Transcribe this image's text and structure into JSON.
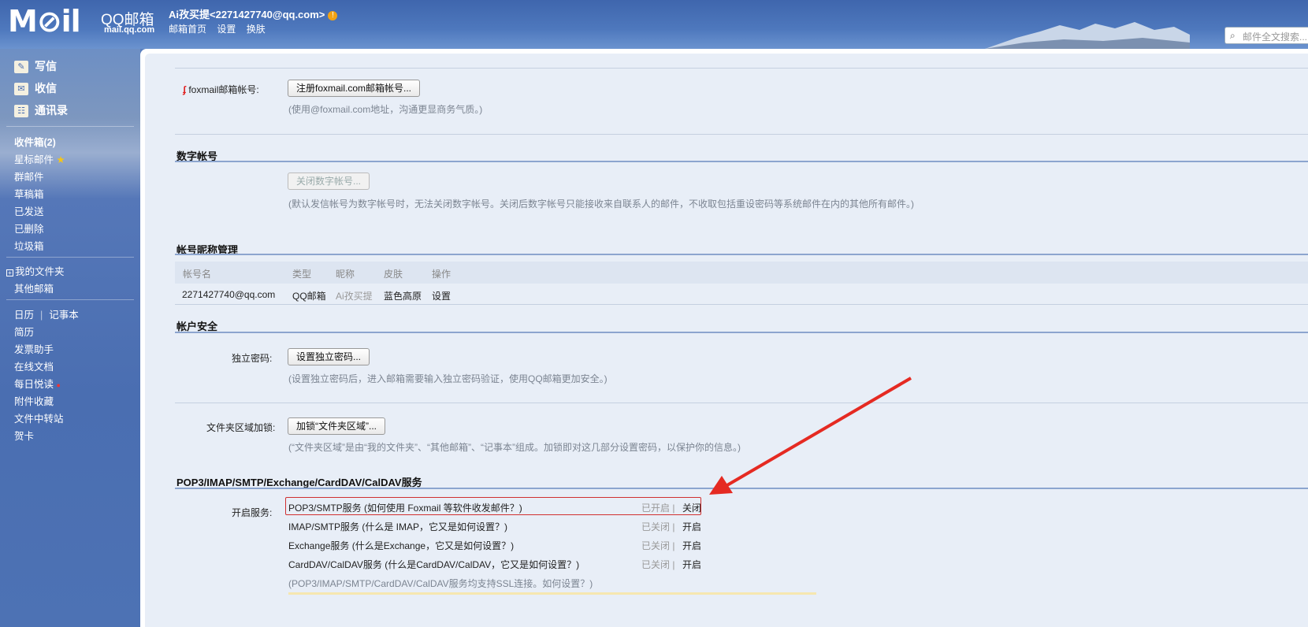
{
  "header": {
    "logo_text": "M⊘il",
    "logo_qq": "QQ邮箱",
    "logo_domain": "mail.qq.com",
    "user_display": "Ai孜买提<2271427740@qq.com>",
    "warn_icon": "!",
    "links": [
      "邮箱首页",
      "设置",
      "换肤"
    ],
    "search_placeholder": "邮件全文搜索..."
  },
  "sidebar": {
    "write": "写信",
    "receive": "收信",
    "contacts": "通讯录",
    "folders": [
      "收件箱(2)",
      "星标邮件",
      "群邮件",
      "草稿箱",
      "已发送",
      "已删除",
      "垃圾箱"
    ],
    "my_folders": "我的文件夹",
    "other_mail": "其他邮箱",
    "calendar": "日历",
    "notes": "记事本",
    "tools": [
      "简历",
      "发票助手",
      "在线文档",
      "每日悦读",
      "附件收藏",
      "文件中转站",
      "贺卡"
    ]
  },
  "foxmail": {
    "label": "foxmail邮箱帐号:",
    "button": "注册foxmail.com邮箱帐号...",
    "note": "(使用@foxmail.com地址，沟通更显商务气质。)"
  },
  "digital_account": {
    "title": "数字帐号",
    "button": "关闭数字帐号...",
    "note": "(默认发信帐号为数字帐号时，无法关闭数字帐号。关闭后数字帐号只能接收来自联系人的邮件，不收取包括重设密码等系统邮件在内的其他所有邮件。)"
  },
  "nickname": {
    "title": "帐号昵称管理",
    "headers": [
      "帐号名",
      "类型",
      "昵称",
      "皮肤",
      "操作"
    ],
    "row": [
      "2271427740@qq.com",
      "QQ邮箱",
      "Ai孜买提",
      "蓝色高原",
      "设置"
    ]
  },
  "security": {
    "title": "帐户安全",
    "pwd_label": "独立密码:",
    "pwd_button": "设置独立密码...",
    "pwd_note": "(设置独立密码后，进入邮箱需要输入独立密码验证，使用QQ邮箱更加安全。)",
    "lock_label": "文件夹区域加锁:",
    "lock_button": "加锁“文件夹区域”...",
    "lock_note": "(“文件夹区域”是由“我的文件夹”、“其他邮箱”、“记事本”组成。加锁即对这几部分设置密码，以保护你的信息。)"
  },
  "services": {
    "title": "POP3/IMAP/SMTP/Exchange/CardDAV/CalDAV服务",
    "label": "开启服务:",
    "items": [
      {
        "name": "POP3/SMTP服务 (如何使用 Foxmail 等软件收发邮件？)",
        "status": "已开启",
        "action": "关闭"
      },
      {
        "name": "IMAP/SMTP服务 (什么是 IMAP，它又是如何设置？)",
        "status": "已关闭",
        "action": "开启"
      },
      {
        "name": "Exchange服务 (什么是Exchange，它又是如何设置？)",
        "status": "已关闭",
        "action": "开启"
      },
      {
        "name": "CardDAV/CalDAV服务 (什么是CardDAV/CalDAV，它又是如何设置？)",
        "status": "已关闭",
        "action": "开启"
      }
    ],
    "ssl_note": "(POP3/IMAP/SMTP/CardDAV/CalDAV服务均支持SSL连接。如何设置？)"
  },
  "colors": {
    "accent": "#4e78bd",
    "highlight_box": "#d03030",
    "arrow": "#e52a22"
  }
}
